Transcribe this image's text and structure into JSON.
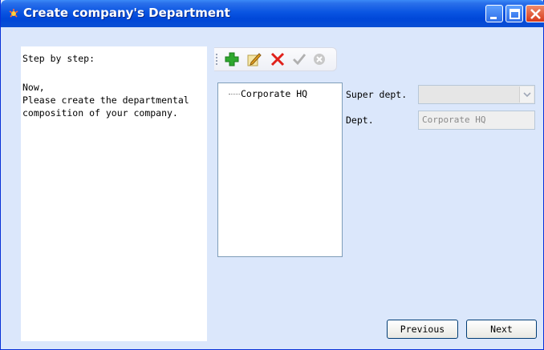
{
  "window": {
    "title": "Create company's Department"
  },
  "left_panel": {
    "lines": [
      "Step by step:",
      "Now,",
      "Please create the departmental",
      "composition of your company."
    ]
  },
  "toolbar": {
    "icons": [
      "add-icon",
      "edit-icon",
      "delete-icon",
      "confirm-icon",
      "cancel-icon"
    ]
  },
  "tree": {
    "items": [
      "Corporate HQ"
    ]
  },
  "form": {
    "super_dept_label": "Super dept.",
    "super_dept_value": "",
    "dept_label": "Dept.",
    "dept_value": "Corporate HQ"
  },
  "buttons": {
    "previous": "Previous",
    "next": "Next"
  },
  "colors": {
    "titlebar": "#0a55e2",
    "window_bg": "#dbe7fb",
    "add": "#2ea82e",
    "delete": "#e0201a"
  }
}
